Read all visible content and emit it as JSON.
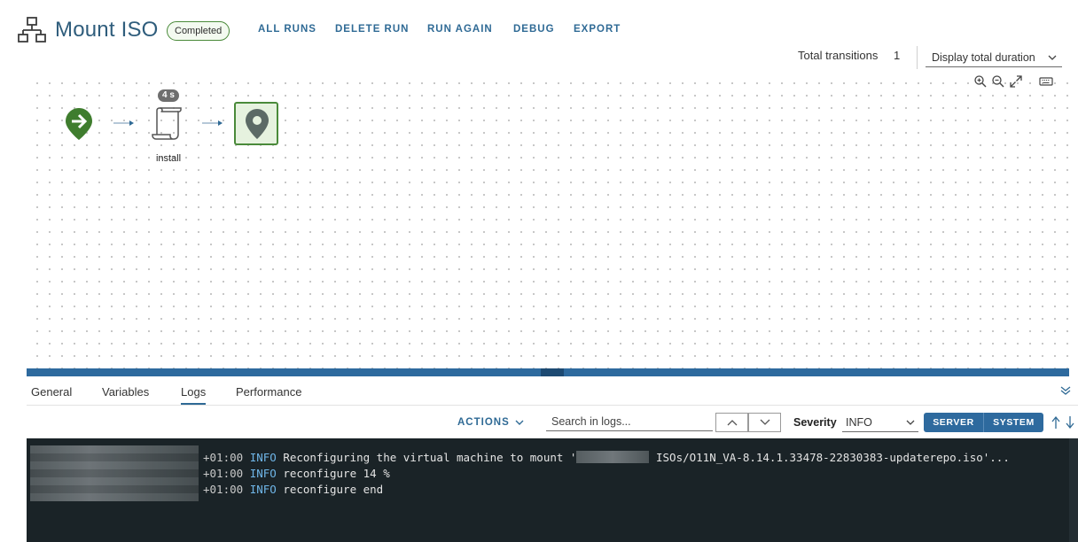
{
  "header": {
    "app_icon": "workflow-hierarchy-icon",
    "title": "Mount ISO",
    "status": "Completed",
    "status_color": "#4a8a3a",
    "actions": [
      "ALL RUNS",
      "DELETE RUN",
      "RUN AGAIN",
      "DEBUG",
      "EXPORT"
    ],
    "transitions_label": "Total transitions",
    "transitions_count": "1",
    "duration_select": "Display total duration"
  },
  "canvas": {
    "tools": [
      "zoom-in-icon",
      "zoom-out-icon",
      "fit-expand-icon",
      "keyboard-icon"
    ],
    "nodes": {
      "start": "start-arrow-icon",
      "install": {
        "label": "install",
        "duration": "4 s",
        "icon": "script-scroll-icon"
      },
      "end": "end-pin-icon"
    }
  },
  "tabs": [
    "General",
    "Variables",
    "Logs",
    "Performance"
  ],
  "active_tab": "Logs",
  "log_toolbar": {
    "actions_label": "ACTIONS",
    "search_placeholder": "Search in logs...",
    "severity_label": "Severity",
    "severity_value": "INFO",
    "toggle": [
      "SERVER",
      "SYSTEM"
    ]
  },
  "logs": [
    {
      "tz": "+01:00",
      "level": "INFO",
      "message_start": "Reconfiguring the virtual machine to mount '",
      "message_end": "ISOs/O11N_VA-8.14.1.33478-22830383-updaterepo.iso'..."
    },
    {
      "tz": "+01:00",
      "level": "INFO",
      "message_start": "reconfigure 14 %"
    },
    {
      "tz": "+01:00",
      "level": "INFO",
      "message_start": "reconfigure end"
    }
  ],
  "colors": {
    "accent": "#2f6a95",
    "title": "#2f5d7c",
    "success": "#4a8a3a",
    "console_bg": "#1a2327",
    "splitter": "#2e6a9e"
  }
}
